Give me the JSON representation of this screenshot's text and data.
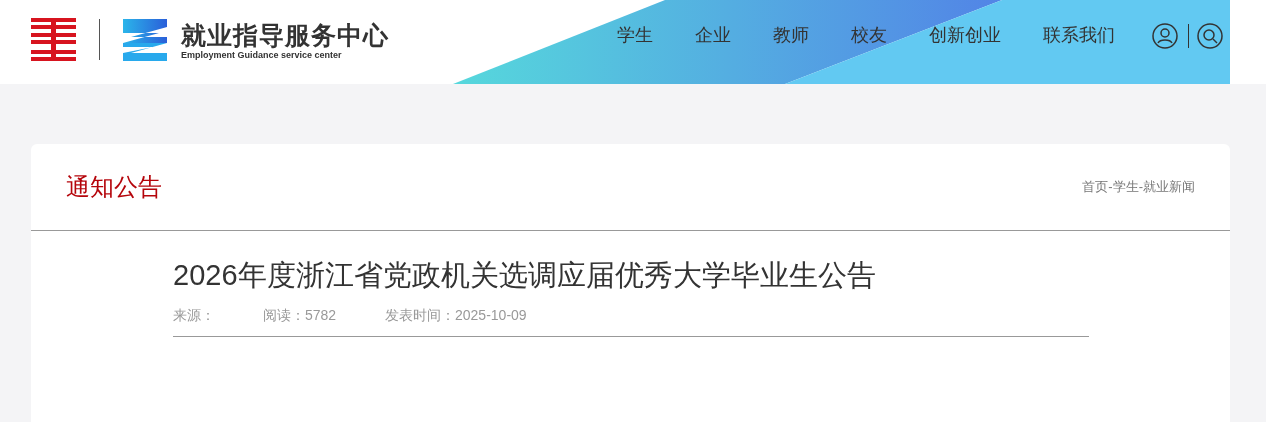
{
  "logo": {
    "title": "就业指导服务中心",
    "subtitle": "Employment Guidance service center"
  },
  "nav": [
    {
      "label": "学生"
    },
    {
      "label": "企业"
    },
    {
      "label": "教师"
    },
    {
      "label": "校友"
    },
    {
      "label": "创新创业"
    },
    {
      "label": "联系我们"
    }
  ],
  "section": {
    "title": "通知公告",
    "breadcrumb": "首页-学生-就业新闻"
  },
  "article": {
    "title": "2026年度浙江省党政机关选调应届优秀大学毕业生公告",
    "meta": [
      "来源：",
      "阅读：5782",
      "发表时间：2025-10-09"
    ]
  }
}
